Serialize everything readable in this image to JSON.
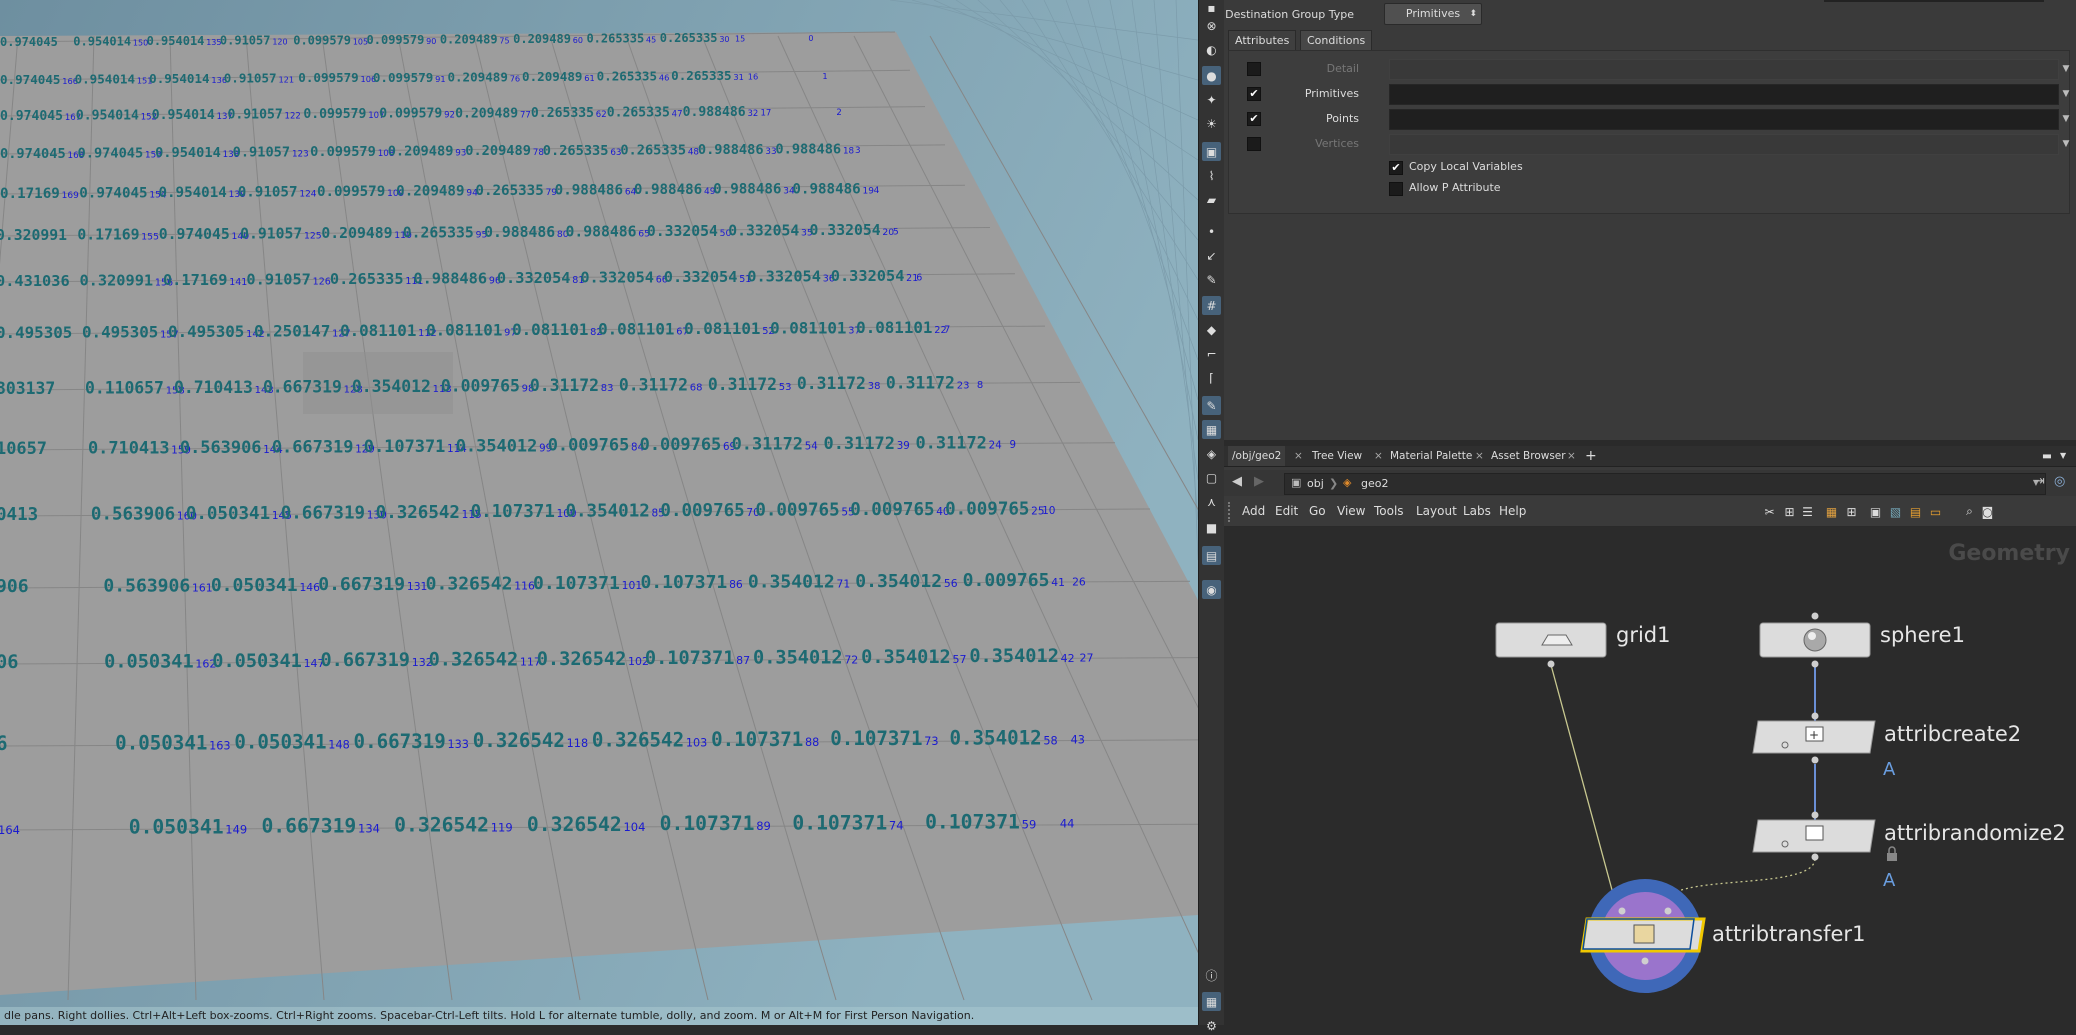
{
  "viewport": {
    "status_hint": "dle pans. Right dollies. Ctrl+Alt+Left box-zooms. Ctrl+Right zooms. Spacebar-Ctrl-Left tilts. Hold L for alternate tumble, dolly, and zoom.    M or Alt+M for First Person Navigation."
  },
  "grid_rows": [
    [
      {
        "v": "0.974045",
        "i": ""
      },
      {
        "v": "0.954014",
        "i": "150"
      },
      {
        "v": "0.954014",
        "i": "135"
      },
      {
        "v": "0.91057",
        "i": "120"
      },
      {
        "v": "0.099579",
        "i": "105"
      },
      {
        "v": "0.099579",
        "i": "90"
      },
      {
        "v": "0.209489",
        "i": "75"
      },
      {
        "v": "0.209489",
        "i": "60"
      },
      {
        "v": "0.265335",
        "i": "45"
      },
      {
        "v": "0.265335",
        "i": "30"
      },
      {
        "v": "",
        "i": "15"
      },
      {
        "v": "",
        "i": "0"
      }
    ],
    [
      {
        "v": "0.974045",
        "i": "166"
      },
      {
        "v": "0.954014",
        "i": "151"
      },
      {
        "v": "0.954014",
        "i": "136"
      },
      {
        "v": "0.91057",
        "i": "121"
      },
      {
        "v": "0.099579",
        "i": "106"
      },
      {
        "v": "0.099579",
        "i": "91"
      },
      {
        "v": "0.209489",
        "i": "76"
      },
      {
        "v": "0.209489",
        "i": "61"
      },
      {
        "v": "0.265335",
        "i": "46"
      },
      {
        "v": "0.265335",
        "i": "31"
      },
      {
        "v": "",
        "i": "16"
      },
      {
        "v": "",
        "i": "1"
      }
    ],
    [
      {
        "v": "0.974045",
        "i": "167"
      },
      {
        "v": "0.954014",
        "i": "152"
      },
      {
        "v": "0.954014",
        "i": "137"
      },
      {
        "v": "0.91057",
        "i": "122"
      },
      {
        "v": "0.099579",
        "i": "107"
      },
      {
        "v": "0.099579",
        "i": "92"
      },
      {
        "v": "0.209489",
        "i": "77"
      },
      {
        "v": "0.265335",
        "i": "62"
      },
      {
        "v": "0.265335",
        "i": "47"
      },
      {
        "v": "0.988486",
        "i": "32"
      },
      {
        "v": "",
        "i": "17"
      },
      {
        "v": "",
        "i": "2"
      }
    ],
    [
      {
        "v": "0.974045",
        "i": "168"
      },
      {
        "v": "0.974045",
        "i": "153"
      },
      {
        "v": "0.954014",
        "i": "138"
      },
      {
        "v": "0.91057",
        "i": "123"
      },
      {
        "v": "0.099579",
        "i": "108"
      },
      {
        "v": "0.209489",
        "i": "93"
      },
      {
        "v": "0.209489",
        "i": "78"
      },
      {
        "v": "0.265335",
        "i": "63"
      },
      {
        "v": "0.265335",
        "i": "48"
      },
      {
        "v": "0.988486",
        "i": "33"
      },
      {
        "v": "0.988486",
        "i": "18"
      },
      {
        "v": "",
        "i": "3"
      }
    ],
    [
      {
        "v": "0.17169",
        "i": "169"
      },
      {
        "v": "0.974045",
        "i": "154"
      },
      {
        "v": "0.954014",
        "i": "139"
      },
      {
        "v": "0.91057",
        "i": "124"
      },
      {
        "v": "0.099579",
        "i": "109"
      },
      {
        "v": "0.209489",
        "i": "94"
      },
      {
        "v": "0.265335",
        "i": "79"
      },
      {
        "v": "0.988486",
        "i": "64"
      },
      {
        "v": "0.988486",
        "i": "49"
      },
      {
        "v": "0.988486",
        "i": "34"
      },
      {
        "v": "0.988486",
        "i": "19"
      },
      {
        "v": "",
        "i": "4"
      }
    ],
    [
      {
        "v": "0.320991",
        "i": ""
      },
      {
        "v": "0.17169",
        "i": "155"
      },
      {
        "v": "0.974045",
        "i": "140"
      },
      {
        "v": "0.91057",
        "i": "125"
      },
      {
        "v": "0.209489",
        "i": "110"
      },
      {
        "v": "0.265335",
        "i": "95"
      },
      {
        "v": "0.988486",
        "i": "80"
      },
      {
        "v": "0.988486",
        "i": "65"
      },
      {
        "v": "0.332054",
        "i": "50"
      },
      {
        "v": "0.332054",
        "i": "35"
      },
      {
        "v": "0.332054",
        "i": "20"
      },
      {
        "v": "",
        "i": "5"
      }
    ],
    [
      {
        "v": "0.431036",
        "i": ""
      },
      {
        "v": "0.320991",
        "i": "156"
      },
      {
        "v": "0.17169",
        "i": "141"
      },
      {
        "v": "0.91057",
        "i": "126"
      },
      {
        "v": "0.265335",
        "i": "111"
      },
      {
        "v": "0.988486",
        "i": "96"
      },
      {
        "v": "0.332054",
        "i": "81"
      },
      {
        "v": "0.332054",
        "i": "66"
      },
      {
        "v": "0.332054",
        "i": "51"
      },
      {
        "v": "0.332054",
        "i": "36"
      },
      {
        "v": "0.332054",
        "i": "21"
      },
      {
        "v": "",
        "i": "6"
      }
    ],
    [
      {
        "v": "0.495305",
        "i": ""
      },
      {
        "v": "0.495305",
        "i": "157"
      },
      {
        "v": "0.495305",
        "i": "142"
      },
      {
        "v": "0.250147",
        "i": "127"
      },
      {
        "v": "0.081101",
        "i": "112"
      },
      {
        "v": "0.081101",
        "i": "97"
      },
      {
        "v": "0.081101",
        "i": "82"
      },
      {
        "v": "0.081101",
        "i": "67"
      },
      {
        "v": "0.081101",
        "i": "52"
      },
      {
        "v": "0.081101",
        "i": "37"
      },
      {
        "v": "0.081101",
        "i": "22"
      },
      {
        "v": "",
        "i": "7"
      }
    ],
    [
      {
        "v": "303137",
        "i": ""
      },
      {
        "v": "0.110657",
        "i": "158"
      },
      {
        "v": "0.710413",
        "i": "143"
      },
      {
        "v": "0.667319",
        "i": "128"
      },
      {
        "v": "0.354012",
        "i": "113"
      },
      {
        "v": "0.009765",
        "i": "98"
      },
      {
        "v": "0.31172",
        "i": "83"
      },
      {
        "v": "0.31172",
        "i": "68"
      },
      {
        "v": "0.31172",
        "i": "53"
      },
      {
        "v": "0.31172",
        "i": "38"
      },
      {
        "v": "0.31172",
        "i": "23"
      },
      {
        "v": "",
        "i": "8"
      }
    ],
    [
      {
        "v": "10657",
        "i": ""
      },
      {
        "v": "0.710413",
        "i": "159"
      },
      {
        "v": "0.563906",
        "i": "144"
      },
      {
        "v": "0.667319",
        "i": "129"
      },
      {
        "v": "0.107371",
        "i": "114"
      },
      {
        "v": "0.354012",
        "i": "99"
      },
      {
        "v": "0.009765",
        "i": "84"
      },
      {
        "v": "0.009765",
        "i": "69"
      },
      {
        "v": "0.31172",
        "i": "54"
      },
      {
        "v": "0.31172",
        "i": "39"
      },
      {
        "v": "0.31172",
        "i": "24"
      },
      {
        "v": "",
        "i": "9"
      }
    ],
    [
      {
        "v": "0413",
        "i": ""
      },
      {
        "v": "0.563906",
        "i": "160"
      },
      {
        "v": "0.050341",
        "i": "145"
      },
      {
        "v": "0.667319",
        "i": "130"
      },
      {
        "v": "0.326542",
        "i": "115"
      },
      {
        "v": "0.107371",
        "i": "100"
      },
      {
        "v": "0.354012",
        "i": "85"
      },
      {
        "v": "0.009765",
        "i": "70"
      },
      {
        "v": "0.009765",
        "i": "55"
      },
      {
        "v": "0.009765",
        "i": "40"
      },
      {
        "v": "0.009765",
        "i": "25"
      },
      {
        "v": "",
        "i": "10"
      }
    ],
    [
      {
        "v": "906",
        "i": ""
      },
      {
        "v": "0.563906",
        "i": "161"
      },
      {
        "v": "0.050341",
        "i": "146"
      },
      {
        "v": "0.667319",
        "i": "131"
      },
      {
        "v": "0.326542",
        "i": "116"
      },
      {
        "v": "0.107371",
        "i": "101"
      },
      {
        "v": "0.107371",
        "i": "86"
      },
      {
        "v": "0.354012",
        "i": "71"
      },
      {
        "v": "0.354012",
        "i": "56"
      },
      {
        "v": "0.009765",
        "i": "41"
      },
      {
        "v": "",
        "i": "26"
      }
    ],
    [
      {
        "v": "06",
        "i": ""
      },
      {
        "v": "0.050341",
        "i": "162"
      },
      {
        "v": "0.050341",
        "i": "147"
      },
      {
        "v": "0.667319",
        "i": "132"
      },
      {
        "v": "0.326542",
        "i": "117"
      },
      {
        "v": "0.326542",
        "i": "102"
      },
      {
        "v": "0.107371",
        "i": "87"
      },
      {
        "v": "0.354012",
        "i": "72"
      },
      {
        "v": "0.354012",
        "i": "57"
      },
      {
        "v": "0.354012",
        "i": "42"
      },
      {
        "v": "",
        "i": "27"
      }
    ],
    [
      {
        "v": "6",
        "i": ""
      },
      {
        "v": "0.050341",
        "i": "163"
      },
      {
        "v": "0.050341",
        "i": "148"
      },
      {
        "v": "0.667319",
        "i": "133"
      },
      {
        "v": "0.326542",
        "i": "118"
      },
      {
        "v": "0.326542",
        "i": "103"
      },
      {
        "v": "0.107371",
        "i": "88"
      },
      {
        "v": "0.107371",
        "i": "73"
      },
      {
        "v": "0.354012",
        "i": "58"
      },
      {
        "v": "",
        "i": "43"
      }
    ],
    [
      {
        "v": "",
        "i": "164"
      },
      {
        "v": "0.050341",
        "i": "149"
      },
      {
        "v": "0.667319",
        "i": "134"
      },
      {
        "v": "0.326542",
        "i": "119"
      },
      {
        "v": "0.326542",
        "i": "104"
      },
      {
        "v": "0.107371",
        "i": "89"
      },
      {
        "v": "0.107371",
        "i": "74"
      },
      {
        "v": "0.107371",
        "i": "59"
      },
      {
        "v": "",
        "i": "44"
      }
    ]
  ],
  "params": {
    "dest_group_type_label": "Destination Group Type",
    "dest_group_type_value": "Primitives",
    "tabs": [
      "Attributes",
      "Conditions"
    ],
    "rows": [
      {
        "label": "Detail",
        "checked": false,
        "enabled": false
      },
      {
        "label": "Primitives",
        "checked": true,
        "enabled": true
      },
      {
        "label": "Points",
        "checked": true,
        "enabled": true
      },
      {
        "label": "Vertices",
        "checked": false,
        "enabled": false
      }
    ],
    "copy_local_vars": "Copy Local Variables",
    "allow_p_attr": "Allow P Attribute"
  },
  "pane_tabs": [
    "/obj/geo2",
    "Tree View",
    "Material Palette",
    "Asset Browser"
  ],
  "path": {
    "obj": "obj",
    "geo": "geo2"
  },
  "menus": [
    "Add",
    "Edit",
    "Go",
    "View",
    "Tools",
    "Layout",
    "Labs",
    "Help"
  ],
  "network": {
    "context": "Geometry",
    "nodes": {
      "grid1": "grid1",
      "sphere1": "sphere1",
      "attribcreate2": "attribcreate2",
      "attribrandomize2": "attribrandomize2",
      "attribtransfer1": "attribtransfer1"
    },
    "badge": "A"
  },
  "colors": {
    "viewport_bg": "#7d9fae",
    "grid_surface": "#9b9b9b",
    "value_text": "#1d6a72",
    "index_text": "#1a1ad0",
    "selected_node": "#f0c800",
    "node_ring": "#3f68b8"
  }
}
